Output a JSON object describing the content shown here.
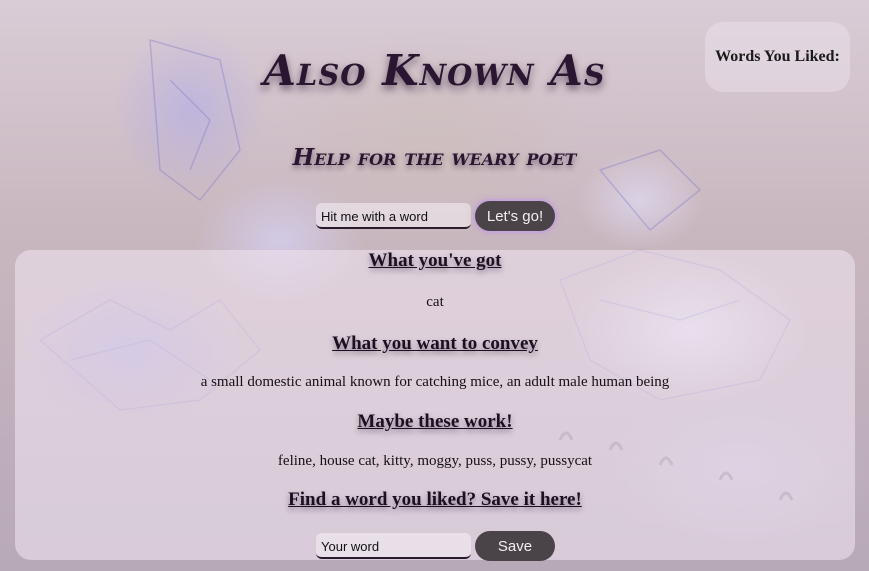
{
  "header": {
    "title": "Also Known As",
    "subtitle": "Help for the weary poet"
  },
  "liked_panel": {
    "title": "Words You Liked:"
  },
  "search": {
    "placeholder": "Hit me with a word",
    "button_label": "Let's go!"
  },
  "results": {
    "got_heading": "What you've got",
    "got_word": "cat",
    "convey_heading": "What you want to convey",
    "convey_text": "a small domestic animal known for catching mice, an adult male human being",
    "maybe_heading": "Maybe these work!",
    "maybe_text": "feline, house cat, kitty, moggy, puss, pussy, pussycat",
    "save_heading": "Find a word you liked? Save it here!"
  },
  "save": {
    "placeholder": "Your word",
    "button_label": "Save"
  },
  "colors": {
    "button_bg": "#4a4348",
    "button_glow": "#c6a6d8",
    "title_text": "#2a1630",
    "panel_bg": "#f0e4f0"
  }
}
